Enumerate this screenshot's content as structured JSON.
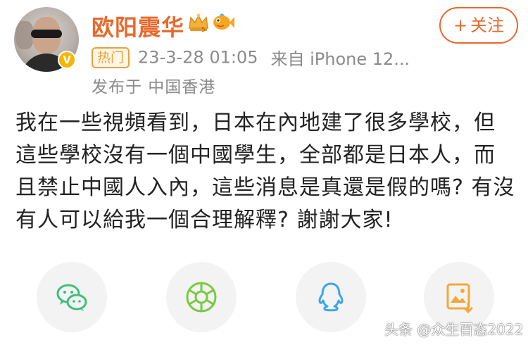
{
  "user": {
    "name": "欧阳震华",
    "verified_mark": "V",
    "avatar_icon": "avatar-photo"
  },
  "badges": [
    "crown-level-icon",
    "fish-badge-icon"
  ],
  "follow_button": {
    "plus": "+",
    "label": "关注"
  },
  "meta": {
    "tag": "热门",
    "timestamp": "23-3-28 01:05",
    "source": "来自 iPhone 12..."
  },
  "location": "发布于 中国香港",
  "post": {
    "text": "我在一些視頻看到，日本在內地建了很多學校，但這些學校沒有一個中國學生，全部都是日本人，而且禁止中國人入內，這些消息是真還是假的嗎? 有沒有人可以給我一個合理解釋? 謝謝大家!"
  },
  "share_icons": [
    "wechat-icon",
    "moments-icon",
    "qq-icon",
    "save-image-icon"
  ],
  "colors": {
    "brand_orange": "#e8692d",
    "hot_tag": "#e6a23c",
    "wechat": "#3fbf7a",
    "moments": "#7ac943",
    "qq": "#3aa7e8",
    "save": "#f2a93b"
  },
  "watermark": "头条 @众生百态2022"
}
